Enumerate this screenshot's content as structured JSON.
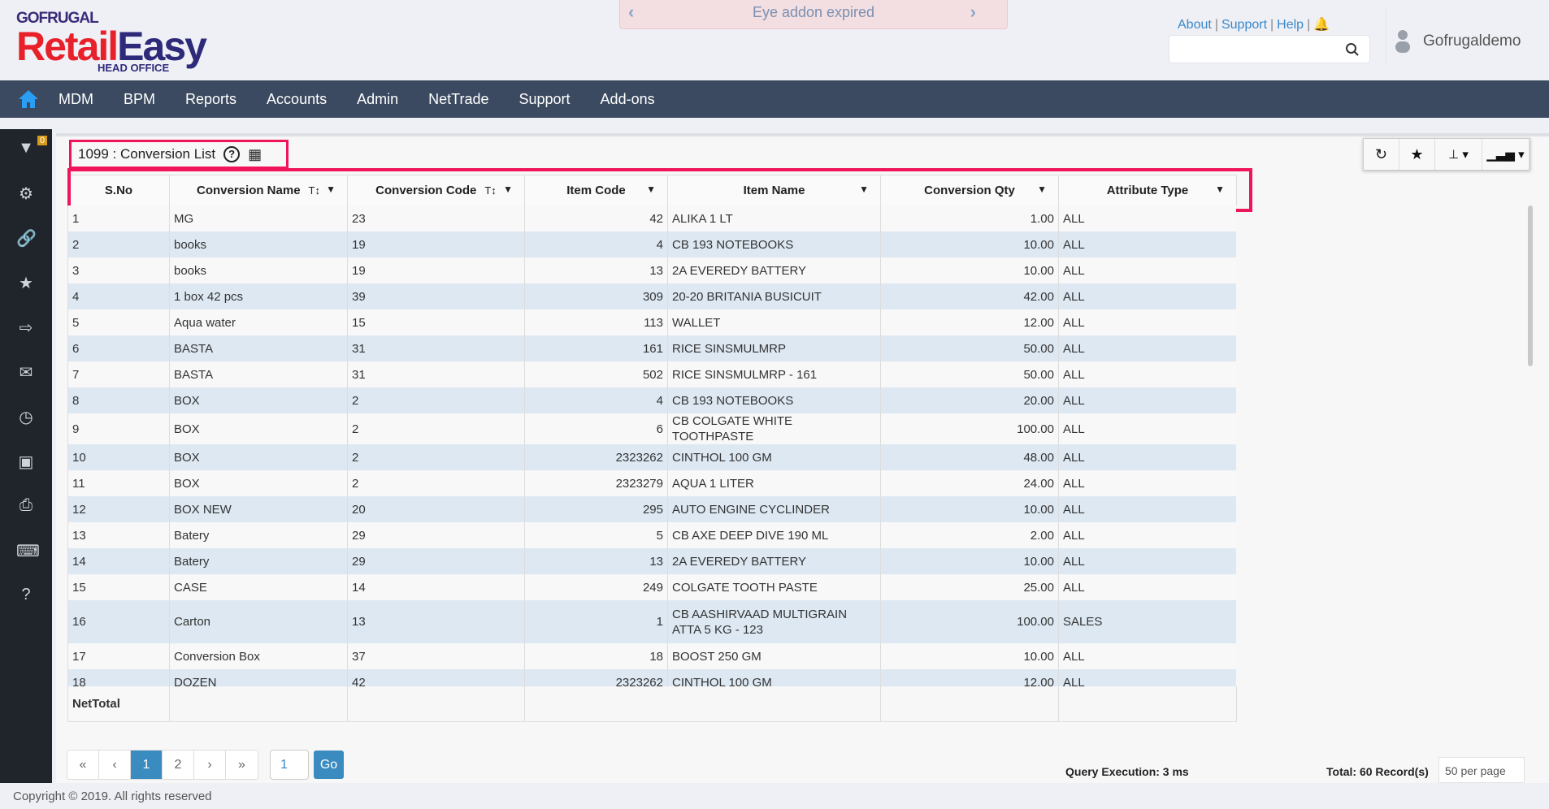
{
  "logo": {
    "brand": "GOFRUGAL",
    "product_a": "Retail",
    "product_b": "Easy",
    "sub": "HEAD OFFICE"
  },
  "banner": {
    "text": "Eye addon expired"
  },
  "toplinks": [
    "About",
    "Support",
    "Help"
  ],
  "user": {
    "name": "Gofrugaldemo"
  },
  "nav": [
    "MDM",
    "BPM",
    "Reports",
    "Accounts",
    "Admin",
    "NetTrade",
    "Support",
    "Add-ons"
  ],
  "filter_badge": "0",
  "page": {
    "title": "1099 : Conversion List"
  },
  "columns": [
    "S.No",
    "Conversion Name",
    "Conversion Code",
    "Item Code",
    "Item Name",
    "Conversion Qty",
    "Attribute Type"
  ],
  "rows": [
    [
      "1",
      "MG",
      "23",
      "42",
      "ALIKA 1 LT",
      "1.00",
      "ALL"
    ],
    [
      "2",
      "books",
      "19",
      "4",
      "CB 193 NOTEBOOKS",
      "10.00",
      "ALL"
    ],
    [
      "3",
      "books",
      "19",
      "13",
      "2A EVEREDY BATTERY",
      "10.00",
      "ALL"
    ],
    [
      "4",
      "1 box 42 pcs",
      "39",
      "309",
      "20-20 BRITANIA BUSICUIT",
      "42.00",
      "ALL"
    ],
    [
      "5",
      "Aqua water",
      "15",
      "113",
      "WALLET",
      "12.00",
      "ALL"
    ],
    [
      "6",
      "BASTA",
      "31",
      "161",
      "RICE SINSMULMRP",
      "50.00",
      "ALL"
    ],
    [
      "7",
      "BASTA",
      "31",
      "502",
      "RICE SINSMULMRP - 161",
      "50.00",
      "ALL"
    ],
    [
      "8",
      "BOX",
      "2",
      "4",
      "CB 193 NOTEBOOKS",
      "20.00",
      "ALL"
    ],
    [
      "9",
      "BOX",
      "2",
      "6",
      "CB COLGATE WHITE TOOTHPASTE",
      "100.00",
      "ALL"
    ],
    [
      "10",
      "BOX",
      "2",
      "2323262",
      "CINTHOL 100 GM",
      "48.00",
      "ALL"
    ],
    [
      "11",
      "BOX",
      "2",
      "2323279",
      "AQUA 1 LITER",
      "24.00",
      "ALL"
    ],
    [
      "12",
      "BOX NEW",
      "20",
      "295",
      "AUTO ENGINE CYCLINDER",
      "10.00",
      "ALL"
    ],
    [
      "13",
      "Batery",
      "29",
      "5",
      "CB AXE DEEP DIVE 190 ML",
      "2.00",
      "ALL"
    ],
    [
      "14",
      "Batery",
      "29",
      "13",
      "2A EVEREDY BATTERY",
      "10.00",
      "ALL"
    ],
    [
      "15",
      "CASE",
      "14",
      "249",
      "COLGATE TOOTH PASTE",
      "25.00",
      "ALL"
    ],
    [
      "16",
      "Carton",
      "13",
      "1",
      "CB AASHIRVAAD MULTIGRAIN ATTA 5 KG - 123",
      "100.00",
      "SALES"
    ],
    [
      "17",
      "Conversion Box",
      "37",
      "18",
      "BOOST 250 GM",
      "10.00",
      "ALL"
    ],
    [
      "18",
      "DOZEN",
      "42",
      "2323262",
      "CINTHOL 100 GM",
      "12.00",
      "ALL"
    ]
  ],
  "net_total_label": "NetTotal",
  "pager": {
    "first": "«",
    "prev": "‹",
    "pages": [
      "1",
      "2"
    ],
    "next": "›",
    "last": "»",
    "current": "1",
    "go": "Go"
  },
  "query_execution": "Query Execution: 3 ms",
  "total_records": "Total: 60 Record(s)",
  "per_page": "50 per page",
  "footer": "Copyright © 2019. All rights reserved"
}
